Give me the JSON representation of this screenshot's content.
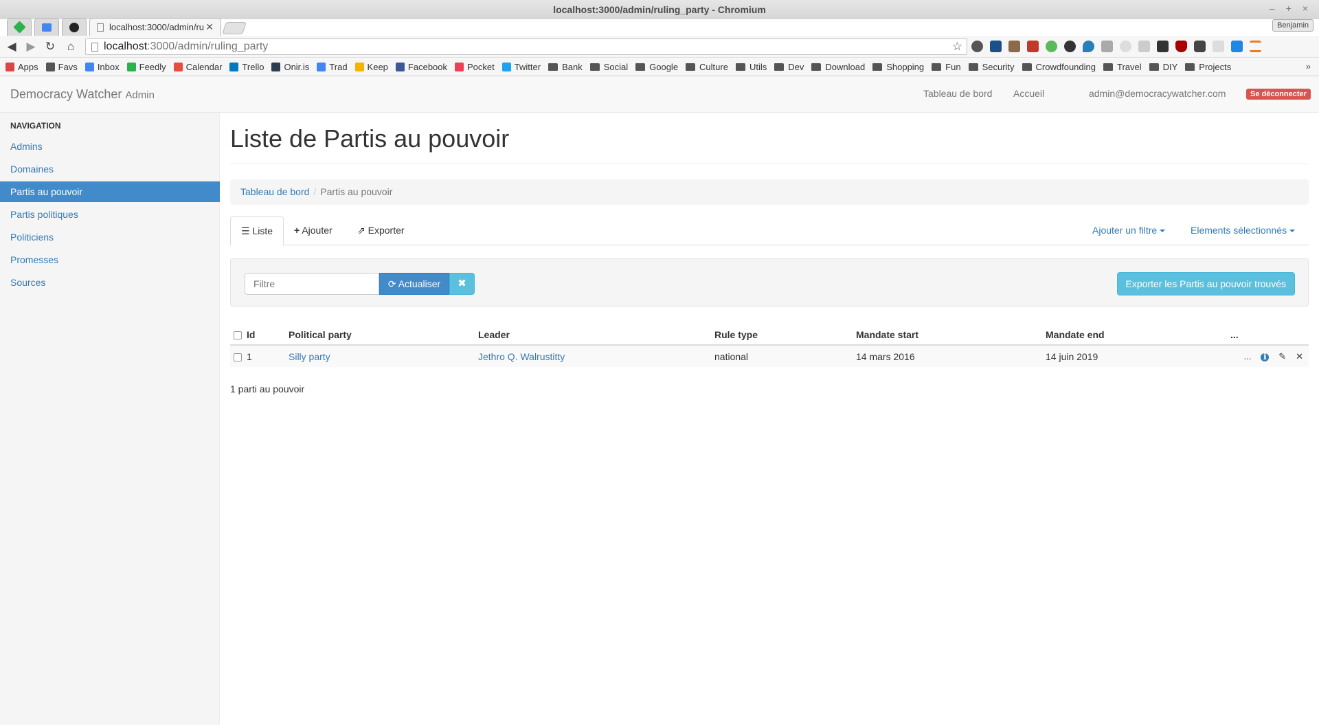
{
  "browser": {
    "window_title": "localhost:3000/admin/ruling_party - Chromium",
    "profile_name": "Benjamin",
    "tab_title": "localhost:3000/admin/ru",
    "url_host": "localhost",
    "url_path": ":3000/admin/ruling_party",
    "bookmarks": [
      {
        "label": "Apps",
        "icon": "apps-grid-icon",
        "color": "#d44"
      },
      {
        "label": "Favs",
        "icon": "star-icon",
        "color": "#555"
      },
      {
        "label": "Inbox",
        "icon": "inbox-icon",
        "color": "#4285f4"
      },
      {
        "label": "Feedly",
        "icon": "feedly-icon",
        "color": "#2bb24c"
      },
      {
        "label": "Calendar",
        "icon": "calendar-icon",
        "color": "#e74c3c"
      },
      {
        "label": "Trello",
        "icon": "trello-icon",
        "color": "#0079bf"
      },
      {
        "label": "Onir.is",
        "icon": "cloud-icon",
        "color": "#2c3e50"
      },
      {
        "label": "Trad",
        "icon": "translate-icon",
        "color": "#4285f4"
      },
      {
        "label": "Keep",
        "icon": "keep-icon",
        "color": "#f4b400"
      },
      {
        "label": "Facebook",
        "icon": "facebook-icon",
        "color": "#3b5998"
      },
      {
        "label": "Pocket",
        "icon": "pocket-icon",
        "color": "#ef4056"
      },
      {
        "label": "Twitter",
        "icon": "twitter-icon",
        "color": "#1da1f2"
      }
    ],
    "bookmark_folders": [
      "Bank",
      "Social",
      "Google",
      "Culture",
      "Utils",
      "Dev",
      "Download",
      "Shopping",
      "Fun",
      "Security",
      "Crowdfounding",
      "Travel",
      "DIY",
      "Projects"
    ]
  },
  "app": {
    "brand": "Democracy Watcher",
    "brand_suffix": "Admin",
    "nav_dashboard": "Tableau de bord",
    "nav_home": "Accueil",
    "user_email": "admin@democracywatcher.com",
    "logout": "Se déconnecter"
  },
  "sidebar": {
    "header": "NAVIGATION",
    "items": [
      {
        "label": "Admins"
      },
      {
        "label": "Domaines"
      },
      {
        "label": "Partis au pouvoir",
        "active": true
      },
      {
        "label": "Partis politiques"
      },
      {
        "label": "Politiciens"
      },
      {
        "label": "Promesses"
      },
      {
        "label": "Sources"
      }
    ]
  },
  "page": {
    "title": "Liste de Partis au pouvoir",
    "breadcrumb_root": "Tableau de bord",
    "breadcrumb_current": "Partis au pouvoir",
    "tabs": {
      "list": "Liste",
      "add": "Ajouter",
      "export": "Exporter"
    },
    "add_filter": "Ajouter un filtre",
    "selected_elements": "Elements sélectionnés",
    "filter_placeholder": "Filtre",
    "refresh": "Actualiser",
    "export_found": "Exporter les Partis au pouvoir trouvés",
    "result_count": "1 parti au pouvoir"
  },
  "table": {
    "columns": [
      "Id",
      "Political party",
      "Leader",
      "Rule type",
      "Mandate start",
      "Mandate end",
      "..."
    ],
    "rows": [
      {
        "id": "1",
        "party": "Silly party",
        "leader": "Jethro Q. Walrustitty",
        "rule_type": "national",
        "start": "14 mars 2016",
        "end": "14 juin 2019",
        "more": "..."
      }
    ]
  }
}
